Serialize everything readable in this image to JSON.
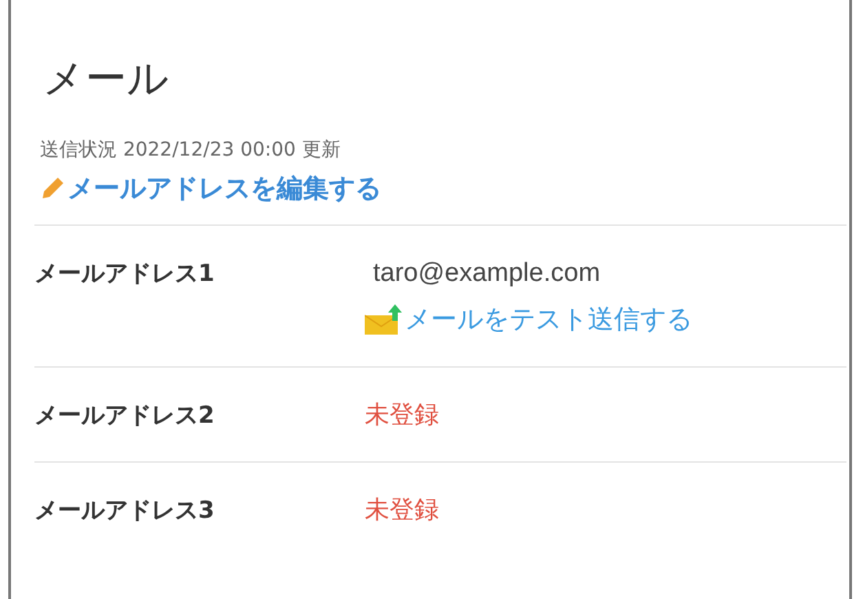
{
  "title": "メール",
  "status": "送信状況 2022/12/23 00:00 更新",
  "edit_link": "メールアドレスを編集する",
  "addresses": [
    {
      "label": "メールアドレス1",
      "kind": "registered",
      "value": "taro@example.com",
      "action": "メールをテスト送信する"
    },
    {
      "label": "メールアドレス2",
      "kind": "unregistered",
      "value": "未登録"
    },
    {
      "label": "メールアドレス3",
      "kind": "unregistered",
      "value": "未登録"
    }
  ]
}
